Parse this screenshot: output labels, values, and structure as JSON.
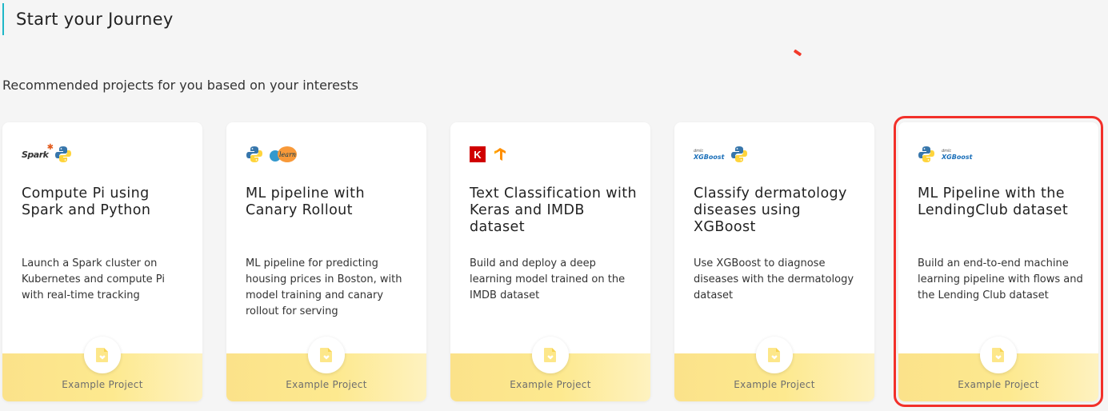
{
  "header": {
    "title": "Start your Journey"
  },
  "subtitle": "Recommended projects for you based on your interests",
  "colors": {
    "accent": "#1fb7c8",
    "highlight": "#f2302a",
    "footer": "#fbe28a"
  },
  "cards": [
    {
      "title": "Compute Pi using Spark and Python",
      "description": "Launch a Spark cluster on Kubernetes and compute Pi with real-time tracking",
      "logos": [
        "spark-logo",
        "python-logo"
      ],
      "logo_text": "Spark",
      "footer_label": "Example Project"
    },
    {
      "title": "ML pipeline with Canary Rollout",
      "description": "ML pipeline for predicting housing prices in Boston, with model training and canary rollout for serving",
      "logos": [
        "python-logo",
        "scikit-learn-logo"
      ],
      "logo_text": "learn",
      "footer_label": "Example Project"
    },
    {
      "title": "Text Classification with Keras and IMDB dataset",
      "description": "Build and deploy a deep learning model trained on the IMDB dataset",
      "logos": [
        "keras-logo",
        "tensorflow-logo"
      ],
      "logo_text": "K",
      "footer_label": "Example Project"
    },
    {
      "title": "Classify dermatology diseases using XGBoost",
      "description": "Use XGBoost to diagnose diseases with the dermatology dataset",
      "logos": [
        "xgboost-logo",
        "python-logo"
      ],
      "logo_text": "XGBoost",
      "footer_label": "Example Project"
    },
    {
      "title": "ML Pipeline with the LendingClub dataset",
      "description": "Build an end-to-end machine learning pipeline with flows and the Lending Club dataset",
      "logos": [
        "python-logo",
        "xgboost-logo"
      ],
      "logo_text": "XGBoost",
      "footer_label": "Example Project"
    }
  ]
}
